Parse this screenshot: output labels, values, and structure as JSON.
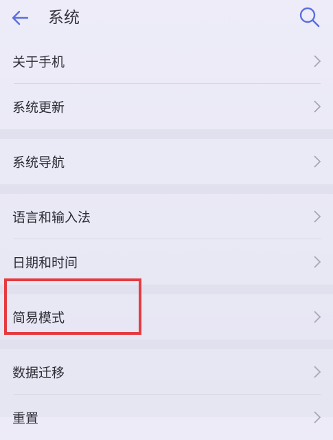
{
  "header": {
    "title": "系统",
    "back_icon": "arrow-left-icon",
    "search_icon": "search-icon"
  },
  "groups": [
    {
      "items": [
        {
          "label": "关于手机"
        },
        {
          "label": "系统更新"
        }
      ]
    },
    {
      "items": [
        {
          "label": "系统导航"
        }
      ]
    },
    {
      "items": [
        {
          "label": "语言和输入法"
        },
        {
          "label": "日期和时间"
        }
      ]
    },
    {
      "items": [
        {
          "label": "简易模式"
        }
      ]
    },
    {
      "items": [
        {
          "label": "数据迁移"
        },
        {
          "label": "重置"
        }
      ]
    }
  ],
  "highlight": {
    "target": "简易模式",
    "color": "#e43b3f"
  }
}
